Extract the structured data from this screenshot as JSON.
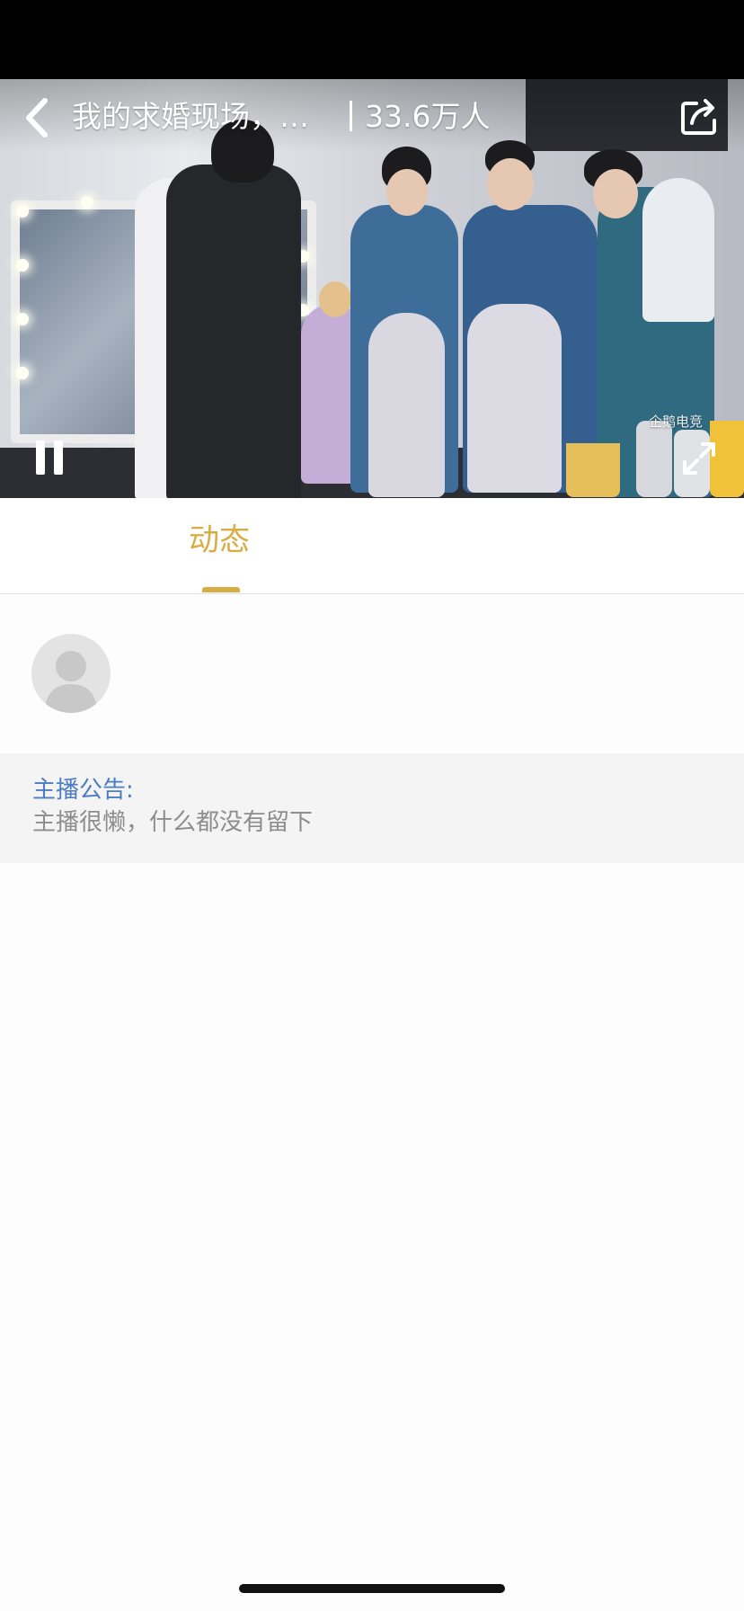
{
  "video": {
    "title": "我的求婚现场，…",
    "viewer_count": "33.6万人",
    "watermark": "企鹅电竞",
    "back_icon": "chevron-left-icon",
    "share_icon": "share-icon",
    "pause_icon": "pause-icon",
    "fullscreen_icon": "fullscreen-icon"
  },
  "tabs": [
    {
      "label": "动态",
      "active": true
    }
  ],
  "streamer": {
    "avatar_icon": "default-avatar-icon"
  },
  "notice": {
    "title": "主播公告:",
    "body": "主播很懒，什么都没有留下"
  },
  "colors": {
    "accent": "#d8ad45",
    "notice_title": "#4c7cc1",
    "notice_body": "#8d8d8d",
    "notice_bg": "#f4f4f4"
  }
}
